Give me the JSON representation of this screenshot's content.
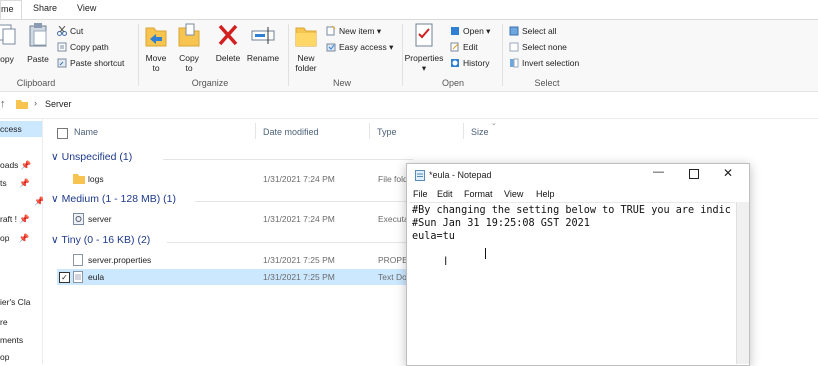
{
  "tabs": {
    "home": "me",
    "share": "Share",
    "view": "View"
  },
  "ribbon": {
    "clipboard": {
      "copy": "opy",
      "paste": "Paste",
      "cut": "Cut",
      "copy_path": "Copy path",
      "paste_shortcut": "Paste shortcut",
      "group": "Clipboard"
    },
    "organize": {
      "move_to": "Move",
      "move_to2": "to",
      "copy_to": "Copy",
      "copy_to2": "to",
      "delete": "Delete",
      "rename": "Rename",
      "group": "Organize"
    },
    "new": {
      "new_folder": "New",
      "new_folder2": "folder",
      "new_item": "New item",
      "easy_access": "Easy access",
      "group": "New"
    },
    "open": {
      "properties": "Properties",
      "open": "Open",
      "edit": "Edit",
      "history": "History",
      "group": "Open"
    },
    "select": {
      "select_all": "Select all",
      "select_none": "Select none",
      "invert": "Invert selection",
      "group": "Select"
    }
  },
  "address": {
    "path": "Server"
  },
  "nav": {
    "items": [
      "ccess",
      "oads",
      "ts",
      "raft !",
      "op",
      "",
      "ier's Cla",
      "",
      "re",
      "ments",
      "op",
      ""
    ]
  },
  "columns": {
    "name": "Name",
    "date": "Date modified",
    "type": "Type",
    "size": "Size"
  },
  "groups": [
    {
      "label": "Unspecified (1)",
      "rows": [
        {
          "name": "logs",
          "date": "1/31/2021 7:24 PM",
          "type": "File folder"
        }
      ]
    },
    {
      "label": "Medium (1 - 128 MB) (1)",
      "rows": [
        {
          "name": "server",
          "date": "1/31/2021 7:24 PM",
          "type": "Executable"
        }
      ]
    },
    {
      "label": "Tiny (0 - 16 KB) (2)",
      "rows": [
        {
          "name": "server.properties",
          "date": "1/31/2021 7:25 PM",
          "type": "PROPERTIES"
        },
        {
          "name": "eula",
          "date": "1/31/2021 7:25 PM",
          "type": "Text Document"
        }
      ]
    }
  ],
  "notepad": {
    "title": "*eula - Notepad",
    "menu": [
      "File",
      "Edit",
      "Format",
      "View",
      "Help"
    ],
    "text": "#By changing the setting below to TRUE you are indic\n#Sun Jan 31 19:25:08 GST 2021\neula=tu"
  },
  "colors": {
    "accent": "#1e3a8a",
    "selection": "#cce8ff",
    "folder": "#f6c44f"
  }
}
